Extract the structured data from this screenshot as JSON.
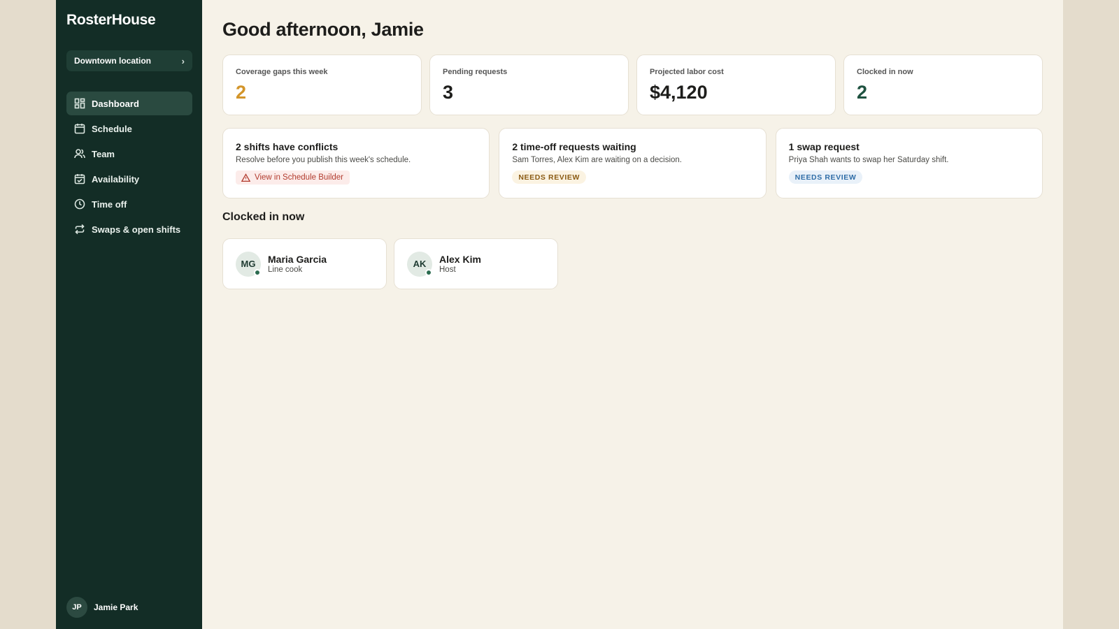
{
  "app": {
    "name": "RosterHouse"
  },
  "sidebar": {
    "location": {
      "label": "Downtown location",
      "icon": "chevron-right-icon"
    },
    "items": [
      {
        "label": "Dashboard",
        "icon": "grid-icon",
        "active": true
      },
      {
        "label": "Schedule",
        "icon": "calendar-icon",
        "active": false
      },
      {
        "label": "Team",
        "icon": "users-icon",
        "active": false
      },
      {
        "label": "Availability",
        "icon": "calendar-check-icon",
        "active": false
      },
      {
        "label": "Time off",
        "icon": "clock-icon",
        "active": false
      },
      {
        "label": "Swaps & open shifts",
        "icon": "swap-icon",
        "active": false
      }
    ],
    "user": {
      "initials": "JP",
      "name": "Jamie Park"
    }
  },
  "main": {
    "greeting": "Good afternoon, Jamie",
    "stats": [
      {
        "label": "Coverage gaps this week",
        "value": "2",
        "color": "#d3952a"
      },
      {
        "label": "Pending requests",
        "value": "3",
        "color": "#1d1d1b"
      },
      {
        "label": "Projected labor cost",
        "value": "$4,120",
        "color": "#1d1d1b"
      },
      {
        "label": "Clocked in now",
        "value": "2",
        "color": "#1f5240"
      }
    ],
    "alerts": [
      {
        "title": "2 shifts have conflicts",
        "description": "Resolve before you publish this week's schedule.",
        "action": "View in Schedule Builder",
        "action_icon": "warning-triangle-icon"
      },
      {
        "title": "2 time-off requests waiting",
        "description": "Sam Torres, Alex Kim are waiting on a decision.",
        "badge": "NEEDS REVIEW"
      },
      {
        "title": "1 swap request",
        "description": "Priya Shah wants to swap her Saturday shift.",
        "badge": "NEEDS REVIEW"
      }
    ],
    "clocked_in": {
      "title": "Clocked in now",
      "people": [
        {
          "initials": "MG",
          "name": "Maria Garcia",
          "role": "Line cook",
          "status": "online"
        },
        {
          "initials": "AK",
          "name": "Alex Kim",
          "role": "Host",
          "status": "online"
        }
      ]
    }
  }
}
